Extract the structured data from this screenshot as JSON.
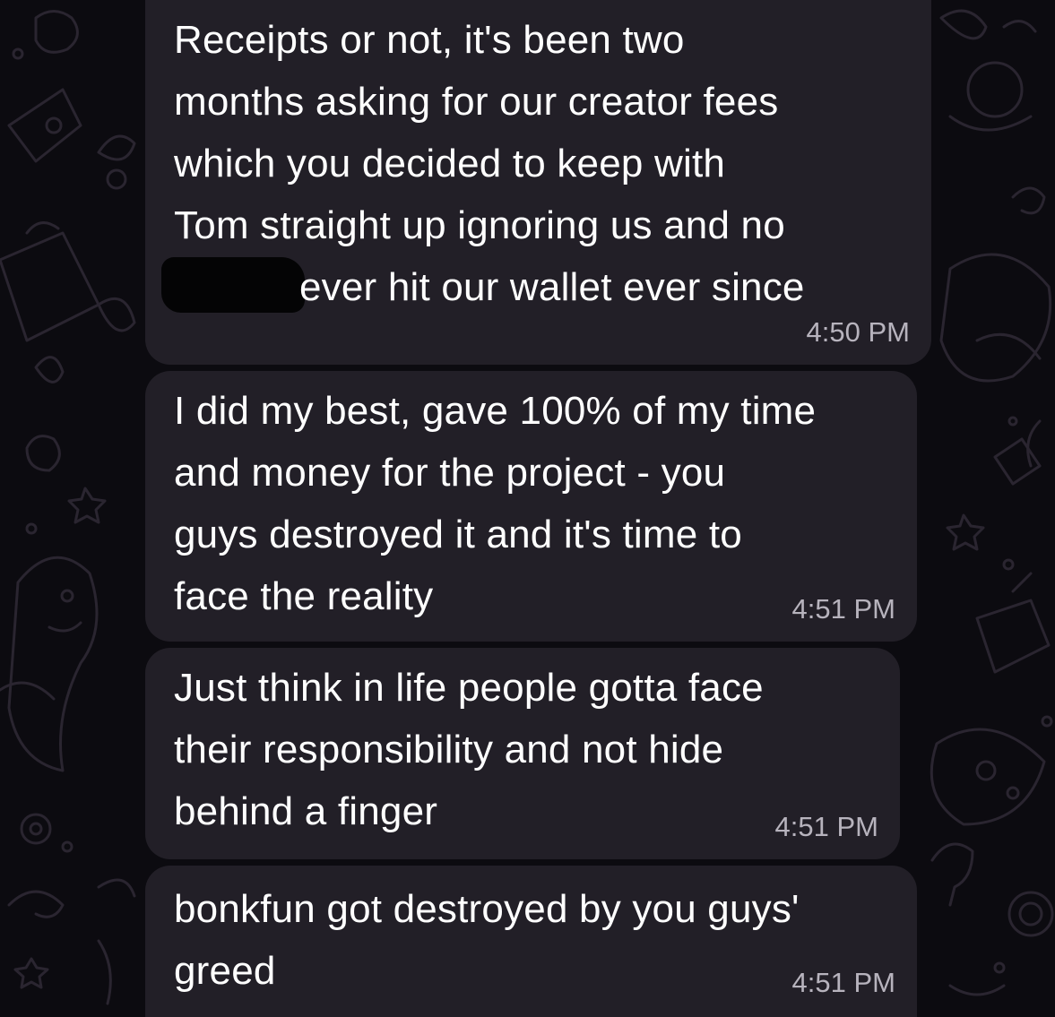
{
  "chat": {
    "messages": [
      {
        "lines": [
          "Receipts or not, it's been two",
          "months asking for our creator fees",
          "which you decided to keep with",
          "Tom straight up ignoring us and no",
          "ever hit our wallet ever since"
        ],
        "redacted_line_index": 4,
        "time": "4:50 PM"
      },
      {
        "lines": [
          "I did my best, gave 100% of my time",
          "and money for the project - you",
          "guys destroyed it and it's time to",
          "face the reality"
        ],
        "time": "4:51 PM"
      },
      {
        "lines": [
          "Just think in life people gotta face",
          "their responsibility and not hide",
          "behind a finger"
        ],
        "time": "4:51 PM"
      },
      {
        "lines": [
          "bonkfun got destroyed by you guys'",
          "greed"
        ],
        "time": "4:51 PM"
      }
    ]
  },
  "colors": {
    "background": "#0c0b10",
    "bubble": "#221f27",
    "text": "#ffffff",
    "timestamp": "#b7b3bd"
  },
  "icons": [
    "doodle-background-pattern"
  ]
}
